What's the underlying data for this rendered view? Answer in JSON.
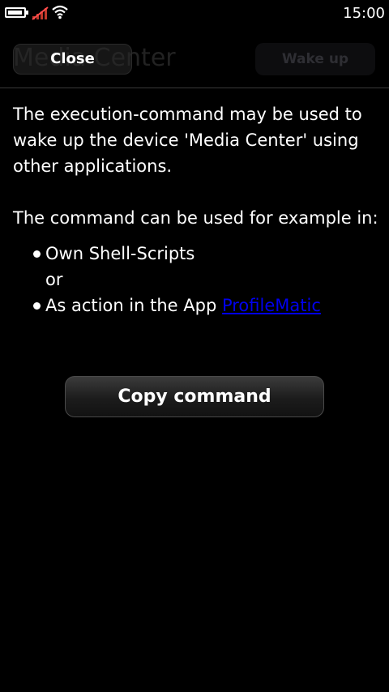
{
  "status_bar": {
    "time": "15:00",
    "icons": [
      "battery-icon",
      "signal-icon",
      "wifi-icon"
    ]
  },
  "header": {
    "title": "Media Center",
    "close_label": "Close",
    "wakeup_label": "Wake up"
  },
  "content": {
    "paragraph1": "The execution-command may be used to wake up the device 'Media Center' using other applications.",
    "paragraph2": "The command can be used for example in:",
    "list_item1": "Own Shell-Scripts",
    "list_or": "or",
    "list_item2_prefix": "As action in the App ",
    "list_item2_link": "ProfileMatic"
  },
  "copy_button_label": "Copy command",
  "colors": {
    "background": "#000000",
    "text": "#ffffff",
    "link": "#0000ee"
  }
}
